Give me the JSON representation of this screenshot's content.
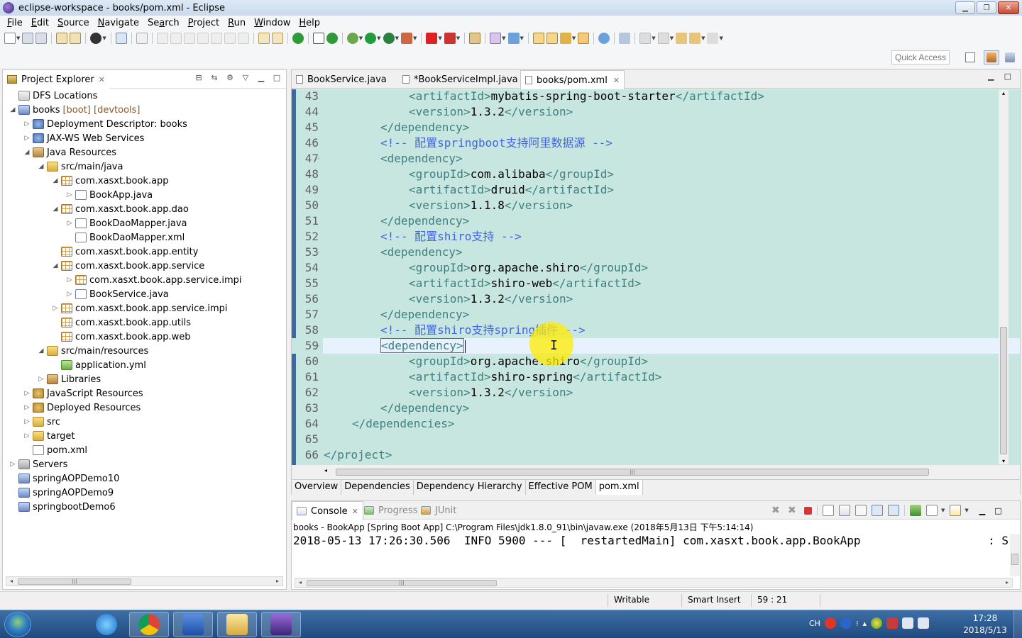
{
  "window": {
    "title": "eclipse-workspace - books/pom.xml - Eclipse",
    "btn_min": "▁",
    "btn_max": "❐",
    "btn_close": "✕"
  },
  "menu": [
    {
      "label": "File",
      "mn": "F",
      "rest": "ile"
    },
    {
      "label": "Edit",
      "mn": "E",
      "rest": "dit"
    },
    {
      "label": "Source",
      "mn": "S",
      "rest": "ource"
    },
    {
      "label": "Navigate",
      "mn": "N",
      "rest": "avigate"
    },
    {
      "label": "Search",
      "mn": "a",
      "pre": "Se",
      "rest": "rch"
    },
    {
      "label": "Project",
      "mn": "P",
      "rest": "roject"
    },
    {
      "label": "Run",
      "mn": "R",
      "rest": "un"
    },
    {
      "label": "Window",
      "mn": "W",
      "rest": "indow"
    },
    {
      "label": "Help",
      "mn": "H",
      "rest": "elp"
    }
  ],
  "quick_access": {
    "placeholder": "Quick Access"
  },
  "explorer": {
    "title": "Project Explorer",
    "close": "✕",
    "tree": [
      {
        "indent": 0,
        "arrow": "",
        "icon": "dfs",
        "label": "DFS Locations",
        "deco": ""
      },
      {
        "indent": 0,
        "arrow": "◢",
        "icon": "project",
        "label": "books",
        "deco": "[boot] [devtools]"
      },
      {
        "indent": 1,
        "arrow": "▷",
        "icon": "gear",
        "label": "Deployment Descriptor: books",
        "deco": ""
      },
      {
        "indent": 1,
        "arrow": "▷",
        "icon": "gear",
        "label": "JAX-WS Web Services",
        "deco": ""
      },
      {
        "indent": 1,
        "arrow": "◢",
        "icon": "lib",
        "label": "Java Resources",
        "deco": ""
      },
      {
        "indent": 2,
        "arrow": "◢",
        "icon": "folder",
        "label": "src/main/java",
        "deco": ""
      },
      {
        "indent": 3,
        "arrow": "◢",
        "icon": "pkg",
        "label": "com.xasxt.book.app",
        "deco": ""
      },
      {
        "indent": 4,
        "arrow": "▷",
        "icon": "java",
        "label": "BookApp.java",
        "deco": ""
      },
      {
        "indent": 3,
        "arrow": "◢",
        "icon": "pkg",
        "label": "com.xasxt.book.app.dao",
        "deco": ""
      },
      {
        "indent": 4,
        "arrow": "▷",
        "icon": "java",
        "label": "BookDaoMapper.java",
        "deco": ""
      },
      {
        "indent": 4,
        "arrow": "",
        "icon": "xml",
        "label": "BookDaoMapper.xml",
        "deco": ""
      },
      {
        "indent": 3,
        "arrow": "",
        "icon": "pkg",
        "label": "com.xasxt.book.app.entity",
        "deco": ""
      },
      {
        "indent": 3,
        "arrow": "◢",
        "icon": "pkg",
        "label": "com.xasxt.book.app.service",
        "deco": ""
      },
      {
        "indent": 4,
        "arrow": "▷",
        "icon": "pkg",
        "label": "com.xasxt.book.app.service.impi",
        "deco": ""
      },
      {
        "indent": 4,
        "arrow": "▷",
        "icon": "java",
        "label": "BookService.java",
        "deco": ""
      },
      {
        "indent": 3,
        "arrow": "▷",
        "icon": "pkg",
        "label": "com.xasxt.book.app.service.impi",
        "deco": ""
      },
      {
        "indent": 3,
        "arrow": "",
        "icon": "pkg",
        "label": "com.xasxt.book.app.utils",
        "deco": ""
      },
      {
        "indent": 3,
        "arrow": "",
        "icon": "pkg",
        "label": "com.xasxt.book.app.web",
        "deco": ""
      },
      {
        "indent": 2,
        "arrow": "◢",
        "icon": "folder",
        "label": "src/main/resources",
        "deco": ""
      },
      {
        "indent": 3,
        "arrow": "",
        "icon": "yml",
        "label": "application.yml",
        "deco": ""
      },
      {
        "indent": 2,
        "arrow": "▷",
        "icon": "lib",
        "label": "Libraries",
        "deco": ""
      },
      {
        "indent": 1,
        "arrow": "▷",
        "icon": "globe",
        "label": "JavaScript Resources",
        "deco": ""
      },
      {
        "indent": 1,
        "arrow": "▷",
        "icon": "globe",
        "label": "Deployed Resources",
        "deco": ""
      },
      {
        "indent": 1,
        "arrow": "▷",
        "icon": "folder",
        "label": "src",
        "deco": ""
      },
      {
        "indent": 1,
        "arrow": "▷",
        "icon": "folder",
        "label": "target",
        "deco": ""
      },
      {
        "indent": 1,
        "arrow": "",
        "icon": "xml",
        "label": "pom.xml",
        "deco": ""
      },
      {
        "indent": 0,
        "arrow": "▷",
        "icon": "servers",
        "label": "Servers",
        "deco": ""
      },
      {
        "indent": 0,
        "arrow": "",
        "icon": "project",
        "label": "springAOPDemo10",
        "deco": ""
      },
      {
        "indent": 0,
        "arrow": "",
        "icon": "project",
        "label": "springAOPDemo9",
        "deco": ""
      },
      {
        "indent": 0,
        "arrow": "",
        "icon": "project",
        "label": "springbootDemo6",
        "deco": ""
      }
    ]
  },
  "editor": {
    "tabs": [
      {
        "label": "BookService.java",
        "active": false,
        "close": ""
      },
      {
        "label": "*BookServiceImpl.java",
        "active": false,
        "close": ""
      },
      {
        "label": "books/pom.xml",
        "active": true,
        "close": "✕"
      }
    ],
    "lines": [
      {
        "n": "43",
        "indent": 3,
        "kind": "elem",
        "tag": "artifactId",
        "value": "mybatis-spring-boot-starter",
        "fold": ""
      },
      {
        "n": "44",
        "indent": 3,
        "kind": "elem",
        "tag": "version",
        "value": "1.3.2",
        "fold": ""
      },
      {
        "n": "45",
        "indent": 2,
        "kind": "close",
        "tag": "dependency",
        "fold": ""
      },
      {
        "n": "46",
        "indent": 2,
        "kind": "comment",
        "text": "<!-- 配置springboot支持阿里数据源 -->",
        "fold": ""
      },
      {
        "n": "47",
        "indent": 2,
        "kind": "open",
        "tag": "dependency",
        "fold": "-"
      },
      {
        "n": "48",
        "indent": 3,
        "kind": "elem",
        "tag": "groupId",
        "value": "com.alibaba",
        "fold": ""
      },
      {
        "n": "49",
        "indent": 3,
        "kind": "elem",
        "tag": "artifactId",
        "value": "druid",
        "fold": ""
      },
      {
        "n": "50",
        "indent": 3,
        "kind": "elem",
        "tag": "version",
        "value": "1.1.8",
        "fold": ""
      },
      {
        "n": "51",
        "indent": 2,
        "kind": "close",
        "tag": "dependency",
        "fold": ""
      },
      {
        "n": "52",
        "indent": 2,
        "kind": "comment",
        "text": "<!-- 配置shiro支持 -->",
        "fold": ""
      },
      {
        "n": "53",
        "indent": 2,
        "kind": "open",
        "tag": "dependency",
        "fold": "-"
      },
      {
        "n": "54",
        "indent": 3,
        "kind": "elem",
        "tag": "groupId",
        "value": "org.apache.shiro",
        "fold": ""
      },
      {
        "n": "55",
        "indent": 3,
        "kind": "elem",
        "tag": "artifactId",
        "value": "shiro-web",
        "fold": ""
      },
      {
        "n": "56",
        "indent": 3,
        "kind": "elem",
        "tag": "version",
        "value": "1.3.2",
        "fold": ""
      },
      {
        "n": "57",
        "indent": 2,
        "kind": "close",
        "tag": "dependency",
        "fold": ""
      },
      {
        "n": "58",
        "indent": 2,
        "kind": "comment",
        "text": "<!-- 配置shiro支持spring插件 -->",
        "fold": ""
      },
      {
        "n": "59",
        "indent": 2,
        "kind": "open",
        "tag": "dependency",
        "fold": "-",
        "current": true
      },
      {
        "n": "60",
        "indent": 3,
        "kind": "elem",
        "tag": "groupId",
        "value": "org.apache.shiro",
        "fold": ""
      },
      {
        "n": "61",
        "indent": 3,
        "kind": "elem",
        "tag": "artifactId",
        "value": "shiro-spring",
        "fold": ""
      },
      {
        "n": "62",
        "indent": 3,
        "kind": "elem",
        "tag": "version",
        "value": "1.3.2",
        "fold": ""
      },
      {
        "n": "63",
        "indent": 2,
        "kind": "close",
        "tag": "dependency",
        "fold": ""
      },
      {
        "n": "64",
        "indent": 1,
        "kind": "close",
        "tag": "dependencies",
        "fold": ""
      },
      {
        "n": "65",
        "indent": 0,
        "kind": "blank",
        "fold": ""
      },
      {
        "n": "66",
        "indent": 0,
        "kind": "close",
        "tag": "project",
        "fold": ""
      }
    ],
    "pom_tabs": [
      {
        "label": "Overview",
        "active": false
      },
      {
        "label": "Dependencies",
        "active": false
      },
      {
        "label": "Dependency Hierarchy",
        "active": false
      },
      {
        "label": "Effective POM",
        "active": false
      },
      {
        "label": "pom.xml",
        "active": true
      }
    ]
  },
  "console": {
    "tabs": [
      {
        "label": "Console",
        "active": true,
        "close": "✕"
      },
      {
        "label": "Progress",
        "active": false,
        "close": ""
      },
      {
        "label": "JUnit",
        "active": false,
        "close": ""
      }
    ],
    "title": "books - BookApp [Spring Boot App] C:\\Program Files\\jdk1.8.0_91\\bin\\javaw.exe (2018年5月13日 下午5:14:14)",
    "output": "2018-05-13 17:26:30.506  INFO 5900 --- [  restartedMain] com.xasxt.book.app.BookApp",
    "output_end": ": S"
  },
  "status": {
    "writable": "Writable",
    "insert_mode": "Smart Insert",
    "position": "59 : 21"
  },
  "taskbar": {
    "ime": "CH",
    "time": "17:28",
    "date": "2018/5/13"
  },
  "colors": {
    "tag": "#3f7f7f",
    "comment": "#4466dd",
    "editor_bg": "#c7e6e0",
    "current_line": "#e8f2fe"
  }
}
